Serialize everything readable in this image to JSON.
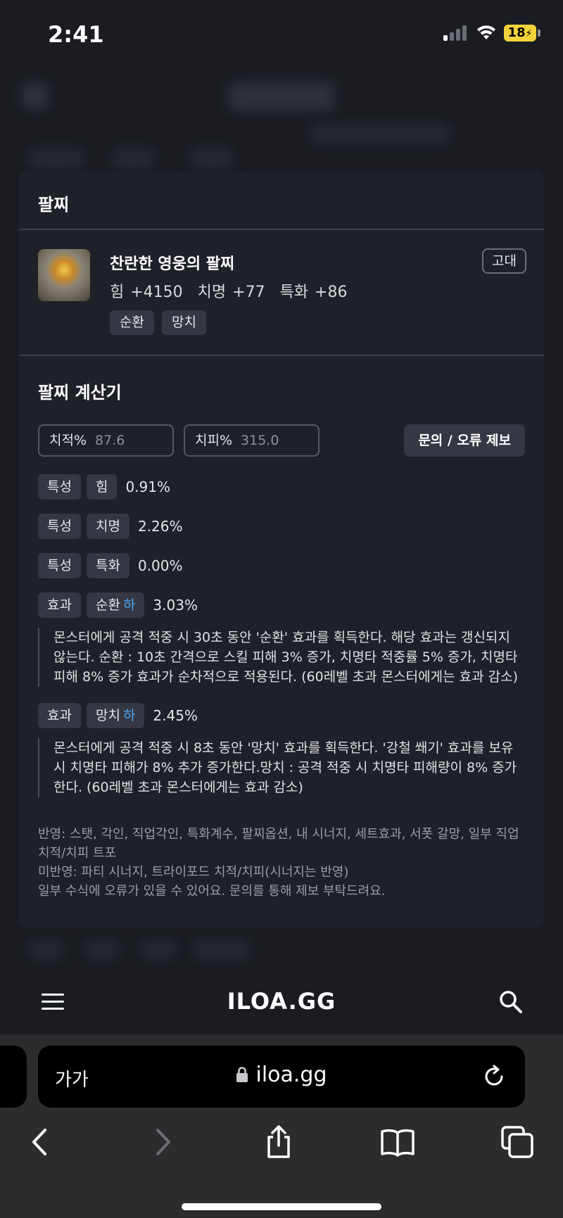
{
  "status_bar": {
    "time": "2:41",
    "battery": "18"
  },
  "panel": {
    "title": "팔찌",
    "item": {
      "name": "찬란한 영웅의 팔찌",
      "grade": "고대",
      "stats": [
        "힘 +4150",
        "치명 +77",
        "특화 +86"
      ],
      "tags": [
        "순환",
        "망치"
      ]
    },
    "calculator": {
      "title": "팔찌 계산기",
      "crit_rate": {
        "label": "치적%",
        "value": "87.6"
      },
      "crit_dmg": {
        "label": "치피%",
        "value": "315.0"
      },
      "report_button": "문의 / 오류 제보",
      "lines": [
        {
          "type": "특성",
          "name": "힘",
          "level": "",
          "percent": "0.91%"
        },
        {
          "type": "특성",
          "name": "치명",
          "level": "",
          "percent": "2.26%"
        },
        {
          "type": "특성",
          "name": "특화",
          "level": "",
          "percent": "0.00%"
        },
        {
          "type": "효과",
          "name": "순환",
          "level": "하",
          "percent": "3.03%",
          "description": "몬스터에게 공격 적중 시 30초 동안 '순환' 효과를 획득한다. 해당 효과는 갱신되지 않는다. 순환 : 10초 간격으로 스킬 피해 3% 증가, 치명타 적중률 5% 증가, 치명타 피해 8% 증가 효과가 순차적으로 적용된다. (60레벨 초과 몬스터에게는 효과 감소)"
        },
        {
          "type": "효과",
          "name": "망치",
          "level": "하",
          "percent": "2.45%",
          "description": "몬스터에게 공격 적중 시 8초 동안 '망치' 효과를 획득한다. '강철 쐐기' 효과를 보유 시 치명타 피해가 8% 추가 증가한다.망치 : 공격 적중 시 치명타 피해량이 8% 증가한다. (60레벨 초과 몬스터에게는 효과 감소)"
        }
      ],
      "notes": [
        "반영: 스탯, 각인, 직업각인, 특화계수, 팔찌옵션, 내 시너지, 세트효과, 서폿 갈망, 일부 직업 치적/치피 트포",
        "미반영: 파티 시너지, 트라이포드 치적/치피(시너지는 반영)",
        "일부 수식에 오류가 있을 수 있어요. 문의를 통해 제보 부탁드려요."
      ]
    }
  },
  "site_nav": {
    "logo": "ILOA.GG"
  },
  "browser": {
    "text_size_label": "가가",
    "url": "iloa.gg"
  }
}
